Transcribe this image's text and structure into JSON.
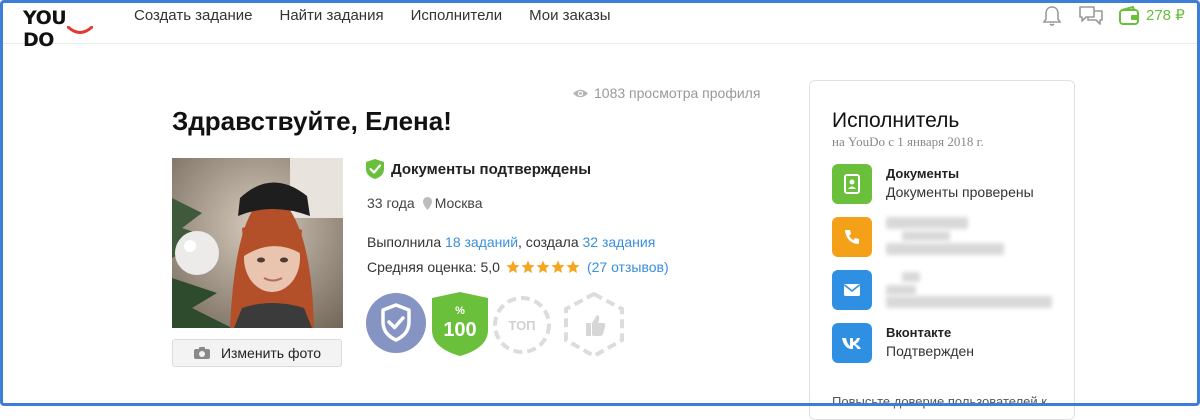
{
  "header": {
    "logo": "YOU DO",
    "nav": [
      {
        "label": "Создать задание"
      },
      {
        "label": "Найти задания"
      },
      {
        "label": "Исполнители"
      },
      {
        "label": "Мои заказы"
      }
    ],
    "balance": "278 ₽"
  },
  "profile": {
    "views": "1083 просмотра профиля",
    "greeting": "Здравствуйте, Елена!",
    "change_photo": "Изменить фото",
    "docs_status": "Документы подтверждены",
    "age": "33 года",
    "city": "Москва",
    "stats_prefix": "Выполнила ",
    "tasks_done": "18 заданий",
    "stats_mid": ", создала ",
    "tasks_created": "32 задания",
    "rating_label": "Средняя оценка: 5,0",
    "rating_value": 5,
    "reviews": "(27 отзывов)",
    "badges": [
      {
        "name": "verified-shield",
        "active": true
      },
      {
        "name": "100-percent",
        "text_top": "%",
        "text": "100",
        "active": true
      },
      {
        "name": "top",
        "text": "ТОП",
        "active": false
      },
      {
        "name": "like",
        "active": false
      }
    ]
  },
  "card": {
    "title": "Исполнитель",
    "since": "на YouDo с 1 января 2018 г.",
    "items": [
      {
        "icon": "document-icon",
        "title": "Документы",
        "subtitle": "Документы проверены",
        "color": "#6abf3b"
      },
      {
        "icon": "phone-icon",
        "title": "",
        "subtitle": "",
        "color": "#f5a019"
      },
      {
        "icon": "email-icon",
        "title": "",
        "subtitle": "",
        "color": "#2f8fe2"
      },
      {
        "icon": "vk-icon",
        "title": "Вконтакте",
        "subtitle": "Подтвержден",
        "color": "#2f8fe2"
      }
    ],
    "footer": "Повысьте доверие пользователей к"
  },
  "colors": {
    "accent_blue": "#3a8fdc",
    "green": "#6abf3b",
    "orange": "#f5a019",
    "star": "#f5a623"
  }
}
